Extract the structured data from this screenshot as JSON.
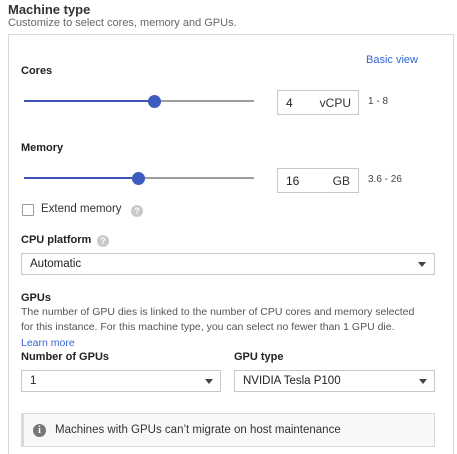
{
  "header": {
    "title": "Machine type",
    "subtitle": "Customize to select cores, memory and GPUs."
  },
  "basic_view_link": "Basic view",
  "cores": {
    "label": "Cores",
    "value": "4",
    "unit": "vCPU",
    "range": "1 - 8",
    "slider_level": 0.57
  },
  "memory": {
    "label": "Memory",
    "value": "16",
    "unit": "GB",
    "range": "3.6 - 26",
    "slider_level": 0.5
  },
  "extend_memory": {
    "label": "Extend memory",
    "checked": false
  },
  "cpu_platform": {
    "label": "CPU platform",
    "selected": "Automatic"
  },
  "gpus": {
    "heading": "GPUs",
    "description_line1": "The number of GPU dies is linked to the number of CPU cores and memory selected",
    "description_line2": "for this instance. For this machine type, you can select no fewer than 1 GPU die.",
    "learn_more": "Learn more",
    "count_label": "Number of GPUs",
    "count_selected": "1",
    "type_label": "GPU type",
    "type_selected": "NVIDIA Tesla P100"
  },
  "notice": {
    "text": "Machines with GPUs can’t migrate on host maintenance"
  },
  "icons": {
    "help": "help-icon",
    "info": "info-icon",
    "dropdown": "chevron-down-icon"
  },
  "colors": {
    "accent": "#3f5bbd",
    "link": "#3367d6"
  }
}
